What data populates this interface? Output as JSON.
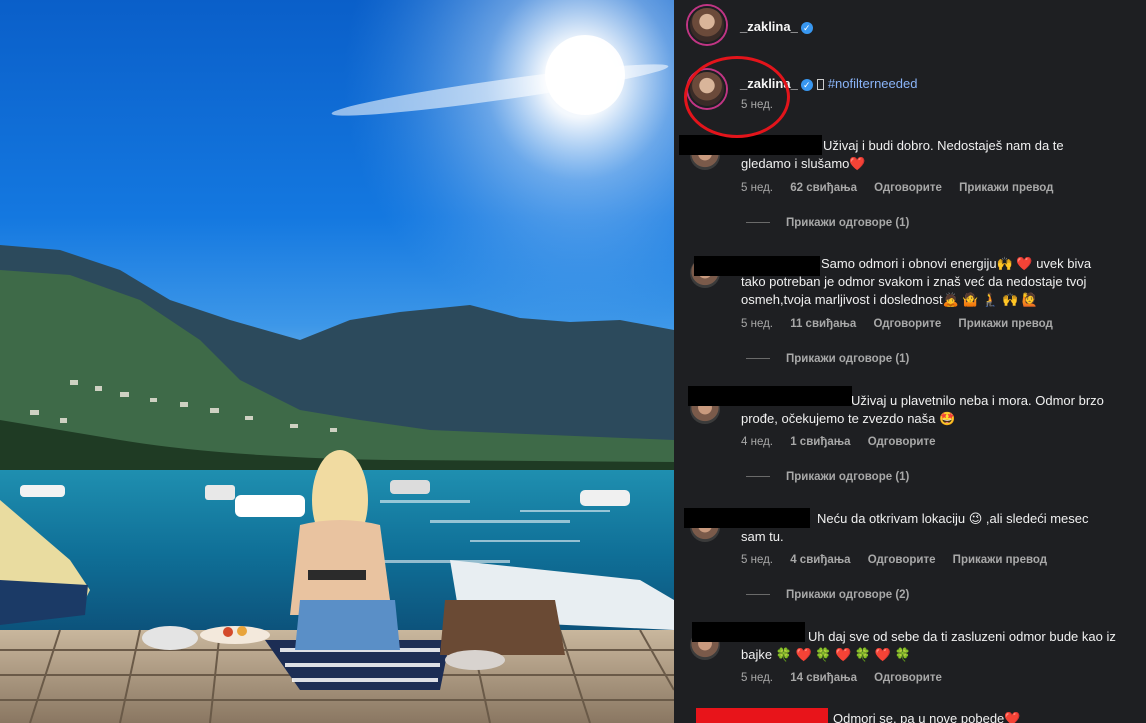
{
  "post": {
    "username": "_zaklina_",
    "caption_username": "_zaklina_",
    "caption_hashtag": "#nofilterneeded",
    "caption_age": "5 нед."
  },
  "labels": {
    "reply": "Одговорите",
    "translate": "Прикажи превод"
  },
  "comments": [
    {
      "text": "Uživaj i budi dobro. Nedostaješ nam da te gledamo i slušamo❤️",
      "age": "5 нед.",
      "likes": "62 свиђања",
      "show_translation": true,
      "replies": "Прикажи одговоре (1)"
    },
    {
      "text": "Samo odmori i obnovi energiju🙌 ❤️ uvek biva tako potreban je odmor svakom i znaš već da nedostaje tvoj osmeh,tvoja marljivost i doslednost🙇 🤷 🧎 🙌 🙋",
      "age": "5 нед.",
      "likes": "11 свиђања",
      "show_translation": true,
      "replies": "Прикажи одговоре (1)"
    },
    {
      "text": "Uživaj u plavetnilo neba i mora. Odmor brzo prođe, očekujemo te zvezdo naša 🤩",
      "age": "4 нед.",
      "likes": "1 свиђања",
      "show_translation": false,
      "replies": "Прикажи одговоре (1)"
    },
    {
      "text": "Neću da otkrivam lokaciju 😉 ,ali sledeći mesec sam tu.",
      "age": "5 нед.",
      "likes": "4 свиђања",
      "show_translation": true,
      "replies": "Прикажи одговоре (2)"
    },
    {
      "text": "Uh daj sve od sebe da ti zasluzeni odmor bude kao iz bajke 🍀 ❤️ 🍀 ❤️ 🍀 ❤️ 🍀",
      "age": "5 нед.",
      "likes": "14 свиђања",
      "show_translation": false,
      "replies": ""
    },
    {
      "text": "Odmori se, pa u nove pobede❤️",
      "age": "",
      "likes": "",
      "show_translation": false,
      "replies": ""
    }
  ],
  "colors": {
    "panel_bg": "#1e1f22",
    "verified": "#3897f0",
    "hashtag": "#8ab4f8",
    "annotation_red": "#e3141b"
  }
}
